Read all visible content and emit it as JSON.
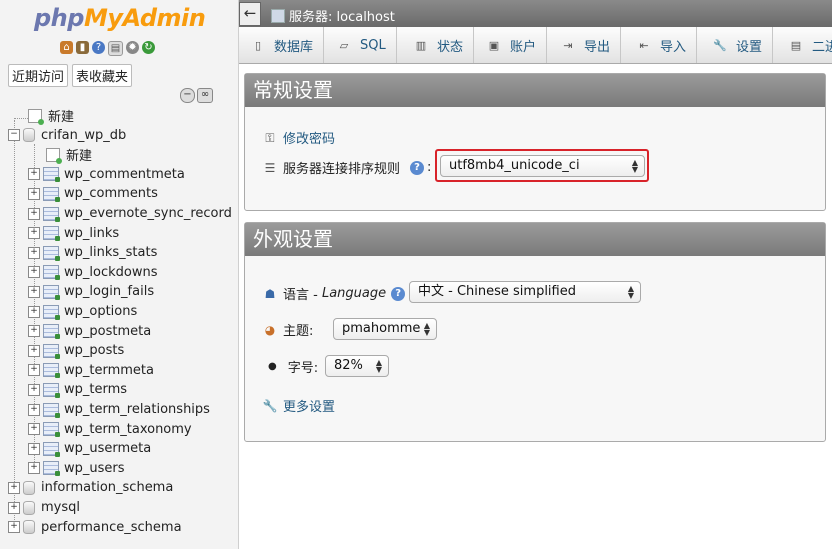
{
  "nav": {
    "logo_php": "php",
    "logo_myadmin": "MyAdmin",
    "icons": [
      "home-icon",
      "exit-icon",
      "help-icon",
      "docs-icon",
      "settings-icon",
      "reload-icon"
    ],
    "buttons": [
      "近期访问",
      "表收藏夹"
    ],
    "tree": {
      "new_label": "新建",
      "databases": [
        {
          "name": "crifan_wp_db",
          "expanded": true,
          "new_label": "新建",
          "tables": [
            "wp_commentmeta",
            "wp_comments",
            "wp_evernote_sync_record",
            "wp_links",
            "wp_links_stats",
            "wp_lockdowns",
            "wp_login_fails",
            "wp_options",
            "wp_postmeta",
            "wp_posts",
            "wp_termmeta",
            "wp_terms",
            "wp_term_relationships",
            "wp_term_taxonomy",
            "wp_usermeta",
            "wp_users"
          ]
        },
        {
          "name": "information_schema",
          "expanded": false
        },
        {
          "name": "mysql",
          "expanded": false
        },
        {
          "name": "performance_schema",
          "expanded": false
        }
      ]
    }
  },
  "topbar": {
    "back": "←",
    "server_label": "服务器: localhost"
  },
  "tabs": [
    {
      "label": "数据库",
      "icon": "database-icon"
    },
    {
      "label": "SQL",
      "icon": "sql-icon"
    },
    {
      "label": "状态",
      "icon": "status-icon"
    },
    {
      "label": "账户",
      "icon": "users-icon"
    },
    {
      "label": "导出",
      "icon": "export-icon"
    },
    {
      "label": "导入",
      "icon": "import-icon"
    },
    {
      "label": "设置",
      "icon": "wrench-icon"
    },
    {
      "label": "二进",
      "icon": "binlog-icon"
    }
  ],
  "general": {
    "title": "常规设置",
    "change_password": "修改密码",
    "collation_label": "服务器连接排序规则",
    "help": "?",
    "colon": ":",
    "collation_value": "utf8mb4_unicode_ci"
  },
  "appearance": {
    "title": "外观设置",
    "language_label_cn": "语言 - ",
    "language_label_en": "Language",
    "language_value": "中文 - Chinese simplified",
    "theme_label": "主题:",
    "theme_value": "pmahomme",
    "fontsize_label": "字号:",
    "fontsize_value": "82%",
    "more_settings": "更多设置"
  },
  "colors": {
    "link": "#235a81",
    "highlight": "#d8232a",
    "group_header": "#8a8a8a"
  }
}
